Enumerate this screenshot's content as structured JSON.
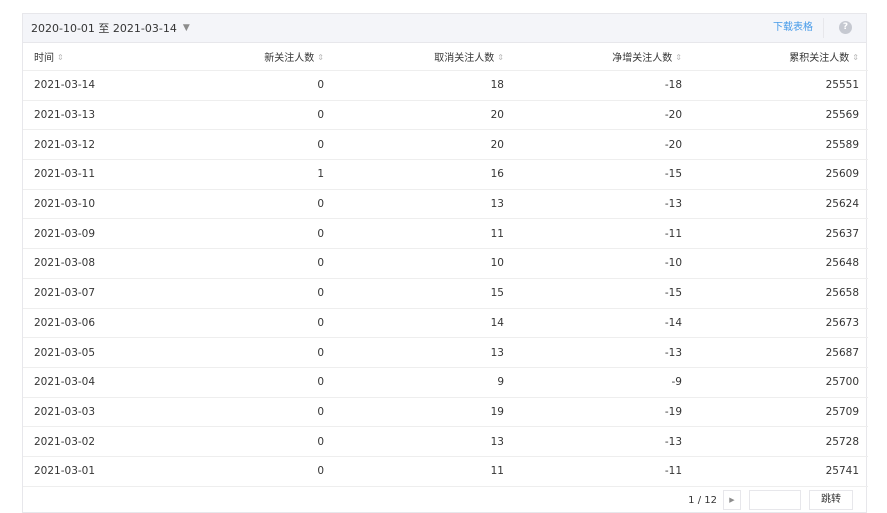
{
  "toolbar": {
    "date_range": "2020-10-01 至 2021-03-14",
    "caret": "▼",
    "download_label": "下载表格",
    "help_label": "?"
  },
  "table": {
    "columns": [
      "时间",
      "新关注人数",
      "取消关注人数",
      "净增关注人数",
      "累积关注人数"
    ],
    "sort_glyph": "⇕",
    "rows": [
      [
        "2021-03-14",
        "0",
        "18",
        "-18",
        "25551"
      ],
      [
        "2021-03-13",
        "0",
        "20",
        "-20",
        "25569"
      ],
      [
        "2021-03-12",
        "0",
        "20",
        "-20",
        "25589"
      ],
      [
        "2021-03-11",
        "1",
        "16",
        "-15",
        "25609"
      ],
      [
        "2021-03-10",
        "0",
        "13",
        "-13",
        "25624"
      ],
      [
        "2021-03-09",
        "0",
        "11",
        "-11",
        "25637"
      ],
      [
        "2021-03-08",
        "0",
        "10",
        "-10",
        "25648"
      ],
      [
        "2021-03-07",
        "0",
        "15",
        "-15",
        "25658"
      ],
      [
        "2021-03-06",
        "0",
        "14",
        "-14",
        "25673"
      ],
      [
        "2021-03-05",
        "0",
        "13",
        "-13",
        "25687"
      ],
      [
        "2021-03-04",
        "0",
        "9",
        "-9",
        "25700"
      ],
      [
        "2021-03-03",
        "0",
        "19",
        "-19",
        "25709"
      ],
      [
        "2021-03-02",
        "0",
        "13",
        "-13",
        "25728"
      ],
      [
        "2021-03-01",
        "0",
        "11",
        "-11",
        "25741"
      ]
    ]
  },
  "pagination": {
    "page_text": "1 / 12",
    "next_glyph": "▶",
    "jump_input_value": "",
    "jump_label": "跳转"
  }
}
